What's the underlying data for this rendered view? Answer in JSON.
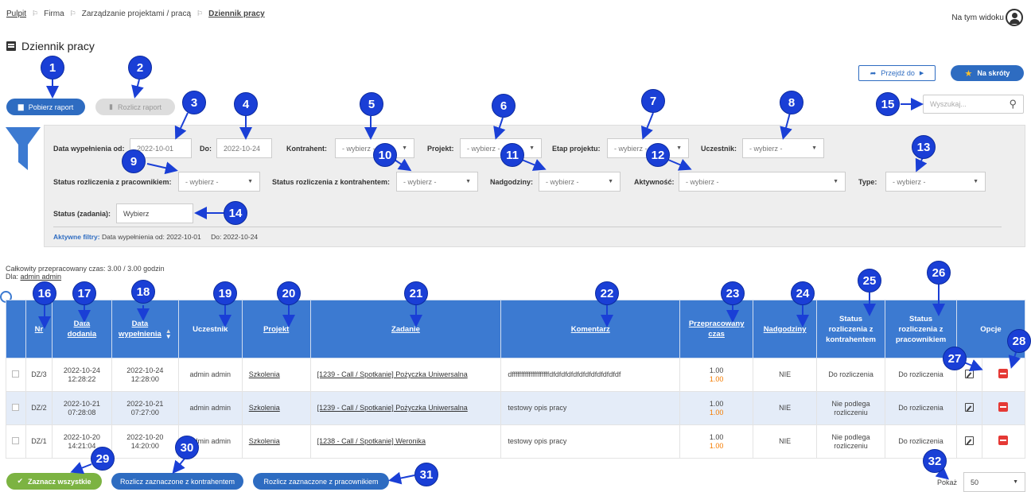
{
  "breadcrumb": [
    "Pulpit",
    "Firma",
    "Zarządzanie projektami / pracą",
    "Dziennik pracy"
  ],
  "header": {
    "view_label": "Na tym widoku"
  },
  "page_title": "Dziennik pracy",
  "toolbar": {
    "download_report": "Pobierz raport",
    "settle_report": "Rozlicz raport",
    "go_to": "Przejdź do",
    "shortcuts": "Na skróty",
    "search_placeholder": "Wyszukaj..."
  },
  "filters": {
    "date_from_label": "Data wypełnienia od:",
    "date_from": "2022-10-01",
    "date_to_label": "Do:",
    "date_to": "2022-10-24",
    "contractor_label": "Kontrahent:",
    "contractor": "- wybierz -",
    "project_label": "Projekt:",
    "project": "- wybierz -",
    "stage_label": "Etap projektu:",
    "stage": "- wybierz -",
    "participant_label": "Uczestnik:",
    "participant": "- wybierz -",
    "emp_status_label": "Status rozliczenia z pracownikiem:",
    "emp_status": "- wybierz -",
    "contr_status_label": "Status rozliczenia z kontrahentem:",
    "contr_status": "- wybierz -",
    "overtime_label": "Nadgodziny:",
    "overtime": "- wybierz -",
    "activity_label": "Aktywność:",
    "activity": "- wybierz -",
    "type_label": "Type:",
    "type": "- wybierz -",
    "task_status_label": "Status (zadania):",
    "task_status": "Wybierz",
    "active_label": "Aktywne filtry:",
    "active_from": "Data wypełnienia od: 2022-10-01",
    "active_to": "Do: 2022-10-24"
  },
  "summary": {
    "total": "Całkowity przepracowany czas: 3.00 / 3.00 godzin",
    "for_label": "Dla:",
    "for_user": "admin admin"
  },
  "table": {
    "headers": {
      "nr": "Nr",
      "added_1": "Data",
      "added_2": "dodania",
      "filled_1": "Data",
      "filled_2": "wypełnienia",
      "participant": "Uczestnik",
      "project": "Projekt",
      "task": "Zadanie",
      "comment": "Komentarz",
      "worked_1": "Przepracowany",
      "worked_2": "czas",
      "overtime": "Nadgodziny",
      "contr_1": "Status",
      "contr_2": "rozliczenia z",
      "contr_3": "kontrahentem",
      "emp_1": "Status",
      "emp_2": "rozliczenia z",
      "emp_3": "pracownikiem",
      "options": "Opcje"
    },
    "rows": [
      {
        "nr": "DZ/3",
        "added_d": "2022-10-24",
        "added_t": "12:28:22",
        "filled_d": "2022-10-24",
        "filled_t": "12:28:00",
        "participant": "admin admin",
        "project": "Szkolenia",
        "task": "[1239 - Call / Spotkanie] Pożyczka Uniwersalna",
        "comment": "dffffffffffffffffffffdfdfdfdfdfdfdfdfdfdfdfdf",
        "hours": "1.00",
        "hours2": "1.00",
        "overtime": "NIE",
        "contr_1": "Do rozliczenia",
        "contr_2": "",
        "emp": "Do rozliczenia"
      },
      {
        "nr": "DZ/2",
        "added_d": "2022-10-21",
        "added_t": "07:28:08",
        "filled_d": "2022-10-21",
        "filled_t": "07:27:00",
        "participant": "admin admin",
        "project": "Szkolenia",
        "task": "[1239 - Call / Spotkanie] Pożyczka Uniwersalna",
        "comment": "testowy opis pracy",
        "hours": "1.00",
        "hours2": "1.00",
        "overtime": "NIE",
        "contr_1": "Nie podlega",
        "contr_2": "rozliczeniu",
        "emp": "Do rozliczenia"
      },
      {
        "nr": "DZ/1",
        "added_d": "2022-10-20",
        "added_t": "14:21:04",
        "filled_d": "2022-10-20",
        "filled_t": "14:20:00",
        "participant": "admin admin",
        "project": "Szkolenia",
        "task": "[1238 - Call / Spotkanie] Weronika",
        "comment": "testowy opis pracy",
        "hours": "1.00",
        "hours2": "1.00",
        "overtime": "NIE",
        "contr_1": "Nie podlega",
        "contr_2": "rozliczeniu",
        "emp": "Do rozliczenia"
      }
    ]
  },
  "bottom": {
    "select_all": "Zaznacz wszystkie",
    "settle_contractor": "Rozlicz zaznaczone z kontrahentem",
    "settle_employee": "Rozlicz zaznaczone z pracownikiem",
    "show_label": "Pokaż",
    "show_value": "50"
  },
  "badges": [
    "1",
    "2",
    "3",
    "4",
    "5",
    "6",
    "7",
    "8",
    "9",
    "10",
    "11",
    "12",
    "13",
    "14",
    "15",
    "16",
    "17",
    "18",
    "19",
    "20",
    "21",
    "22",
    "23",
    "24",
    "25",
    "26",
    "27",
    "28",
    "29",
    "30",
    "31",
    "32"
  ],
  "colors": {
    "header_blue": "#3c7ad1",
    "badge_blue": "#1a3fd6",
    "primary": "#2e6cc1",
    "green": "#7cb342",
    "delete_red": "#e53935",
    "overtime_orange": "#f57c00"
  }
}
